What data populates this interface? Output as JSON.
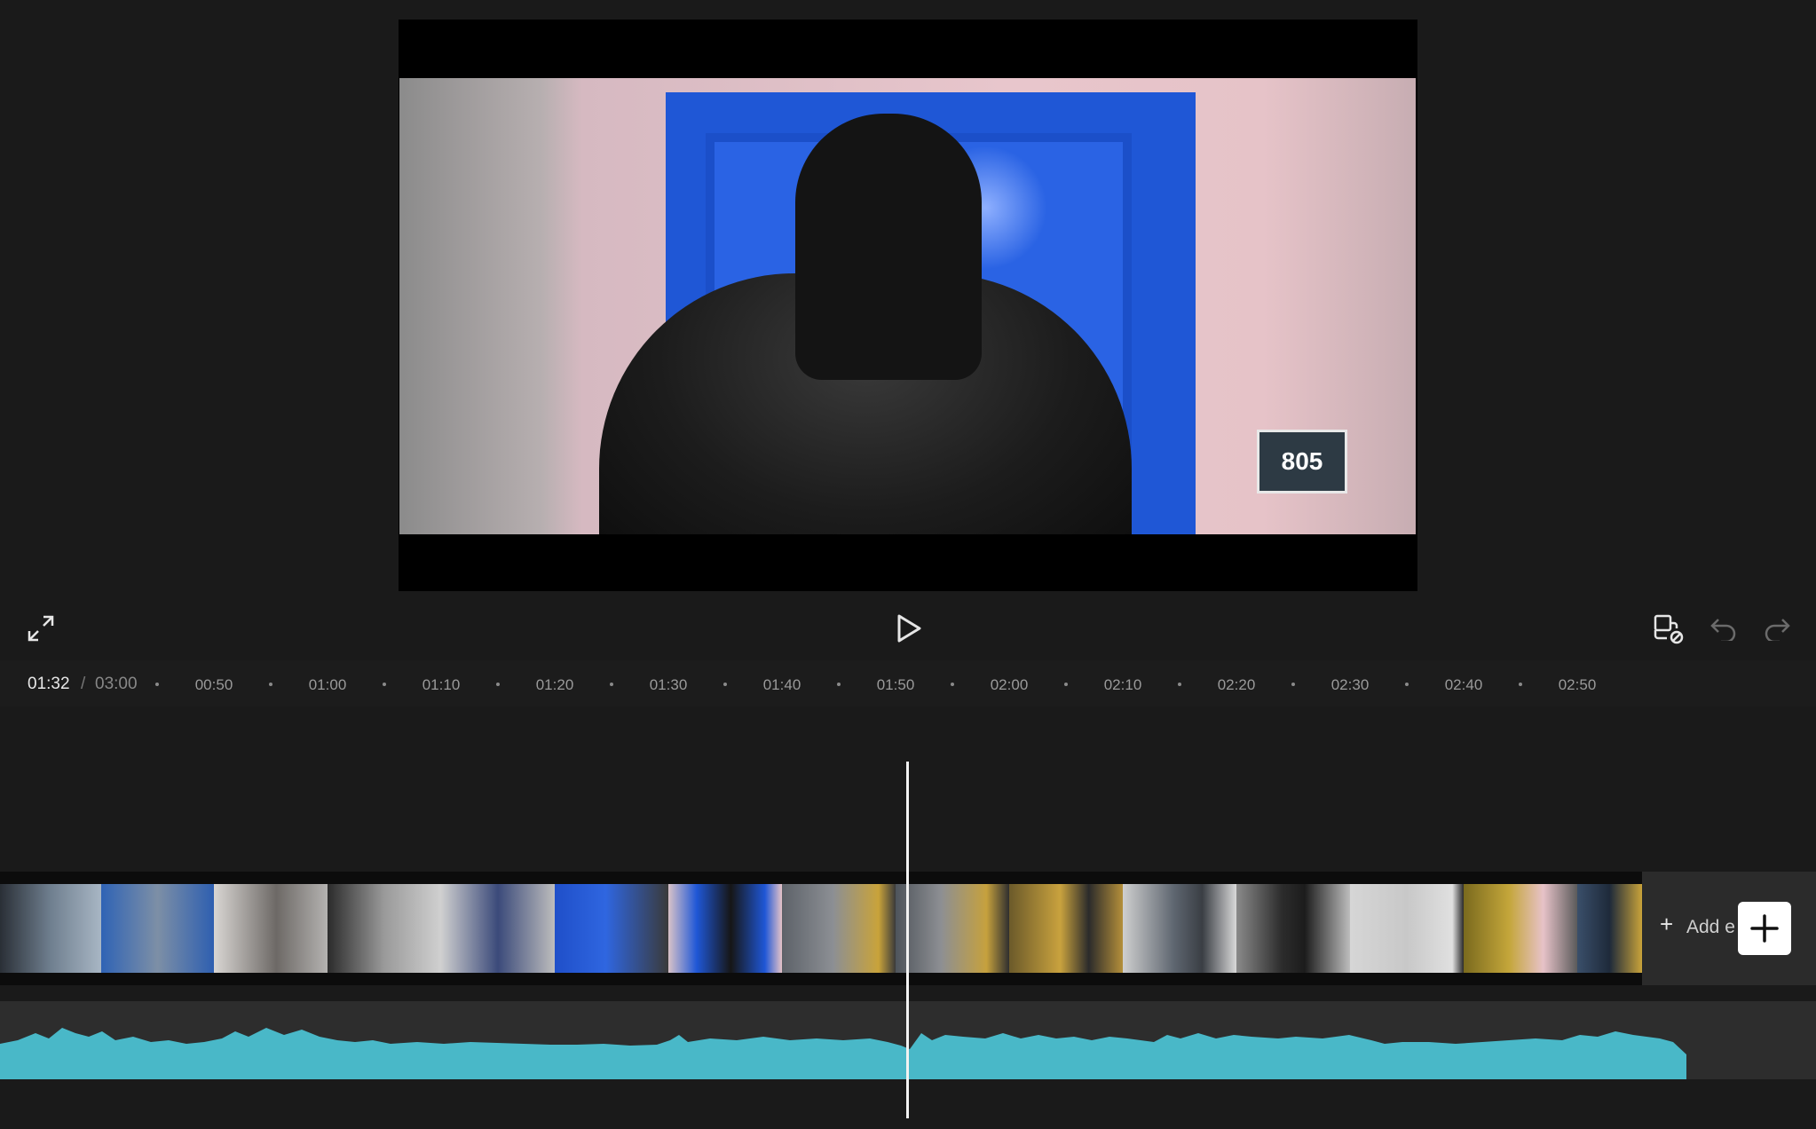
{
  "preview": {
    "door_number": "805"
  },
  "controls": {
    "fullscreen_icon": "expand-icon",
    "play_icon": "play-icon",
    "right_icons": [
      "clip-link-icon",
      "undo-icon",
      "redo-icon"
    ]
  },
  "timeline": {
    "current_time": "01:32",
    "separator": "/",
    "total_time": "03:00",
    "ticks": [
      "00:50",
      "01:00",
      "01:10",
      "01:20",
      "01:30",
      "01:40",
      "01:50",
      "02:00",
      "02:10",
      "02:20",
      "02:30",
      "02:40",
      "02:50"
    ],
    "add_label": "Add e",
    "add_icon": "plus-icon"
  },
  "colors": {
    "background": "#1a1a1a",
    "waveform": "#49b8c8",
    "playhead": "#f2f2f2"
  }
}
